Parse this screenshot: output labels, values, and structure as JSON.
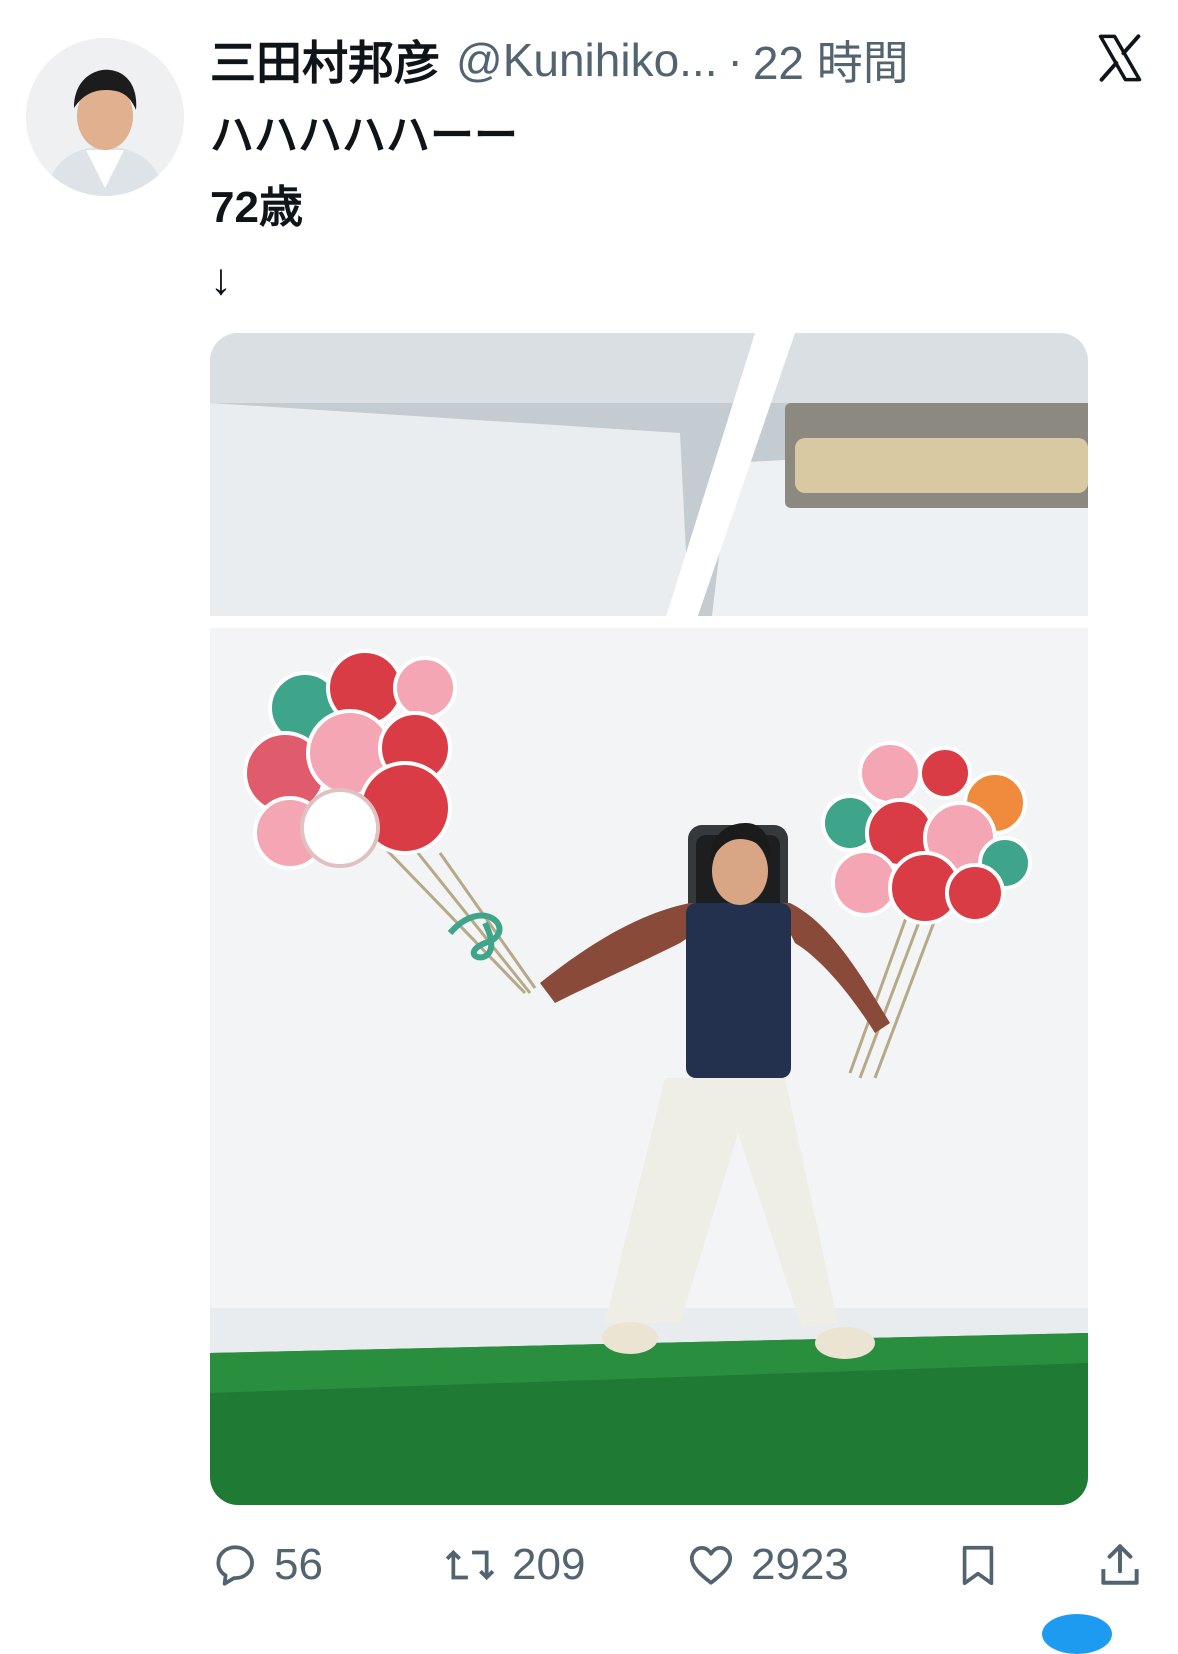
{
  "author": {
    "name": "三田村邦彦",
    "handle": "@Kunihiko...",
    "separator": "·",
    "time": "22 時間"
  },
  "tweet": {
    "lines": [
      "ハハハハハーー",
      "72歳",
      "↓"
    ]
  },
  "media": {
    "icon": "photo",
    "floor_color": "#1f7a33",
    "wall_color": "#f2f4f5"
  },
  "actions": {
    "replies": "56",
    "retweets": "209",
    "likes": "2923"
  },
  "icons": {
    "platform": "x-logo-icon",
    "reply": "reply-icon",
    "retweet": "retweet-icon",
    "like": "heart-icon",
    "bookmark": "bookmark-icon",
    "share": "share-icon"
  }
}
